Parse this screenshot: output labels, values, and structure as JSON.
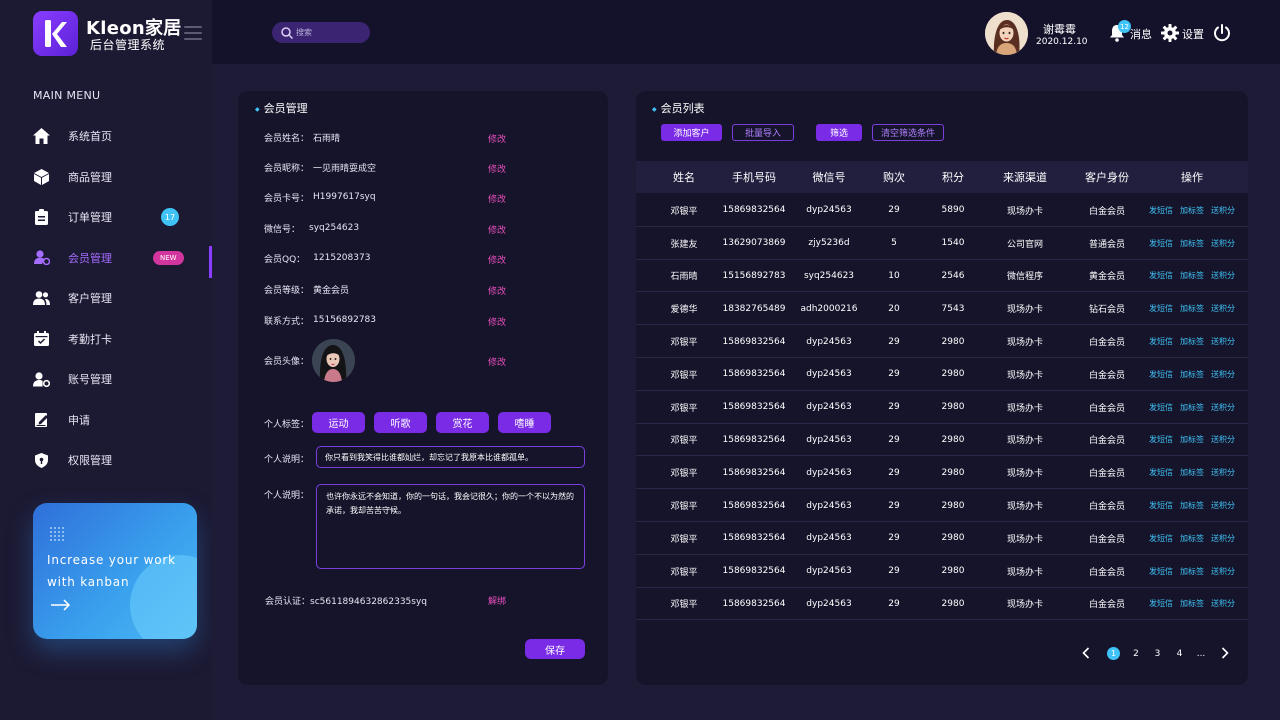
{
  "brand": {
    "name": "Kleon家居",
    "subtitle": "后台管理系统"
  },
  "menu": {
    "title": "MAIN MENU",
    "items": [
      {
        "label": "系统首页",
        "icon": "home-icon"
      },
      {
        "label": "商品管理",
        "icon": "box-icon"
      },
      {
        "label": "订单管理",
        "icon": "clipboard-icon",
        "badge": "17"
      },
      {
        "label": "会员管理",
        "icon": "member-icon",
        "badge_new": "NEW",
        "active": true
      },
      {
        "label": "客户管理",
        "icon": "users-icon"
      },
      {
        "label": "考勤打卡",
        "icon": "calendar-icon"
      },
      {
        "label": "账号管理",
        "icon": "account-settings-icon"
      },
      {
        "label": "申请",
        "icon": "edit-icon"
      },
      {
        "label": "权限管理",
        "icon": "shield-icon"
      }
    ]
  },
  "kanban": {
    "text": "Increase your work with kanban"
  },
  "search": {
    "placeholder": "搜索"
  },
  "user": {
    "name": "谢霉霉",
    "date": "2020.12.10"
  },
  "header": {
    "notif_count": "12",
    "messages_label": "消息",
    "settings_label": "设置"
  },
  "colors": {
    "accent": "#7a2be6",
    "cyan": "#3fc3f6",
    "pink": "#e84fbc",
    "bg": "#14122b"
  },
  "member": {
    "title": "会员管理",
    "edit_label": "修改",
    "fields": [
      {
        "label": "会员姓名：",
        "value": "石雨晴"
      },
      {
        "label": "会员昵称：",
        "value": "一见雨晴耍成空"
      },
      {
        "label": "会员卡号：",
        "value": "H1997617syq"
      },
      {
        "label": "微信号：",
        "value": "syq254623"
      },
      {
        "label": "会员QQ：",
        "value": "1215208373"
      },
      {
        "label": "会员等级：",
        "value": "黄金会员"
      },
      {
        "label": "联系方式：",
        "value": "15156892783"
      }
    ],
    "avatar_label": "会员头像：",
    "tags_label": "个人标签：",
    "tags": [
      "运动",
      "听歌",
      "赏花",
      "嗜睡"
    ],
    "desc_label": "个人说明：",
    "desc_value": "你只看到我笑得比谁都灿烂，却忘记了我原本比谁都孤单。",
    "desc2_label": "个人说明：",
    "desc2_value": "也许你永远不会知道，你的一句话，我会记很久；你的一个不以为然的承诺，我却苦苦守候。",
    "cert_label": "会员认证：",
    "cert_value": "sc5611894632862335syq",
    "unbind_label": "解绑",
    "save_label": "保存"
  },
  "list": {
    "title": "会员列表",
    "buttons": {
      "add": "添加客户",
      "import": "批量导入",
      "filter": "筛选",
      "clear": "清空筛选条件"
    },
    "columns": [
      "姓名",
      "手机号码",
      "微信号",
      "购次",
      "积分",
      "来源渠道",
      "客户身份",
      "操作"
    ],
    "actions": [
      "发短信",
      "加标签",
      "送积分"
    ],
    "rows": [
      [
        "邓银平",
        "15869832564",
        "dyp24563",
        "29",
        "5890",
        "现场办卡",
        "白金会员"
      ],
      [
        "张建友",
        "13629073869",
        "zjy5236d",
        "5",
        "1540",
        "公司官网",
        "普通会员"
      ],
      [
        "石雨晴",
        "15156892783",
        "syq254623",
        "10",
        "2546",
        "微信程序",
        "黄金会员"
      ],
      [
        "爱德华",
        "18382765489",
        "adh2000216",
        "20",
        "7543",
        "现场办卡",
        "钻石会员"
      ],
      [
        "邓银平",
        "15869832564",
        "dyp24563",
        "29",
        "2980",
        "现场办卡",
        "白金会员"
      ],
      [
        "邓银平",
        "15869832564",
        "dyp24563",
        "29",
        "2980",
        "现场办卡",
        "白金会员"
      ],
      [
        "邓银平",
        "15869832564",
        "dyp24563",
        "29",
        "2980",
        "现场办卡",
        "白金会员"
      ],
      [
        "邓银平",
        "15869832564",
        "dyp24563",
        "29",
        "2980",
        "现场办卡",
        "白金会员"
      ],
      [
        "邓银平",
        "15869832564",
        "dyp24563",
        "29",
        "2980",
        "现场办卡",
        "白金会员"
      ],
      [
        "邓银平",
        "15869832564",
        "dyp24563",
        "29",
        "2980",
        "现场办卡",
        "白金会员"
      ],
      [
        "邓银平",
        "15869832564",
        "dyp24563",
        "29",
        "2980",
        "现场办卡",
        "白金会员"
      ],
      [
        "邓银平",
        "15869832564",
        "dyp24563",
        "29",
        "2980",
        "现场办卡",
        "白金会员"
      ],
      [
        "邓银平",
        "15869832564",
        "dyp24563",
        "29",
        "2980",
        "现场办卡",
        "白金会员"
      ]
    ],
    "pagination": {
      "pages": [
        "1",
        "2",
        "3",
        "4"
      ],
      "ellipsis": "...",
      "current": "1"
    }
  }
}
